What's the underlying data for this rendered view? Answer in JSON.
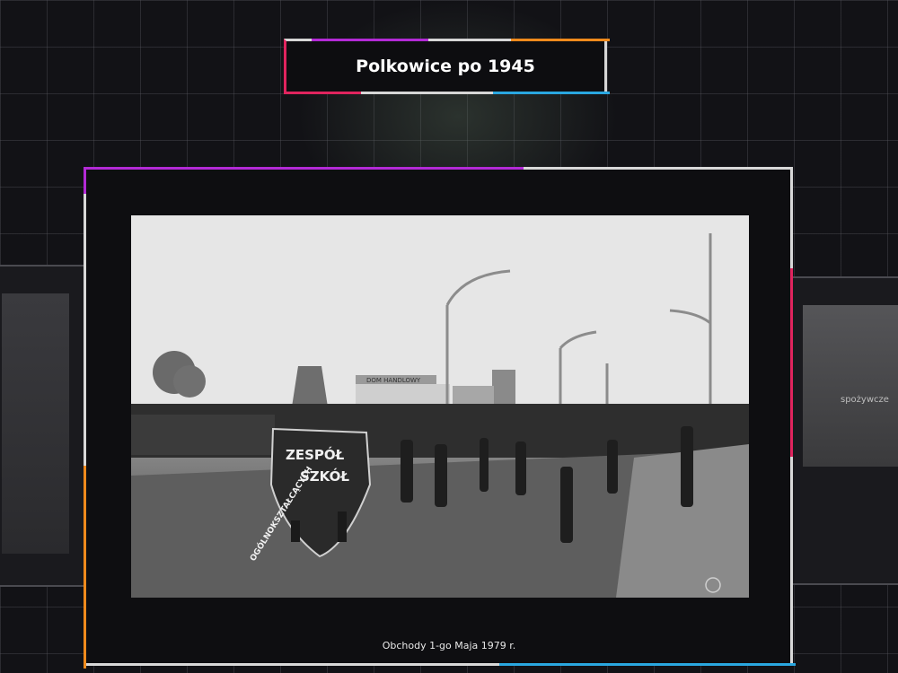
{
  "exhibit": {
    "title": "Polkowice po 1945",
    "caption": "Obchody 1-go Maja 1979 r."
  },
  "photo": {
    "banner_text": [
      "ZESPÓŁ",
      "SZKÓŁ",
      "OGÓLNOKSZTAŁCĄCYCH"
    ],
    "sign_text": "DOM HANDLOWY"
  },
  "side_panels": {
    "right_label": "spożywcze"
  },
  "colors": {
    "accent_purple": "#b32ad6",
    "accent_orange": "#f08a1c",
    "accent_pink": "#e0245e",
    "accent_blue": "#2aa7e0"
  }
}
